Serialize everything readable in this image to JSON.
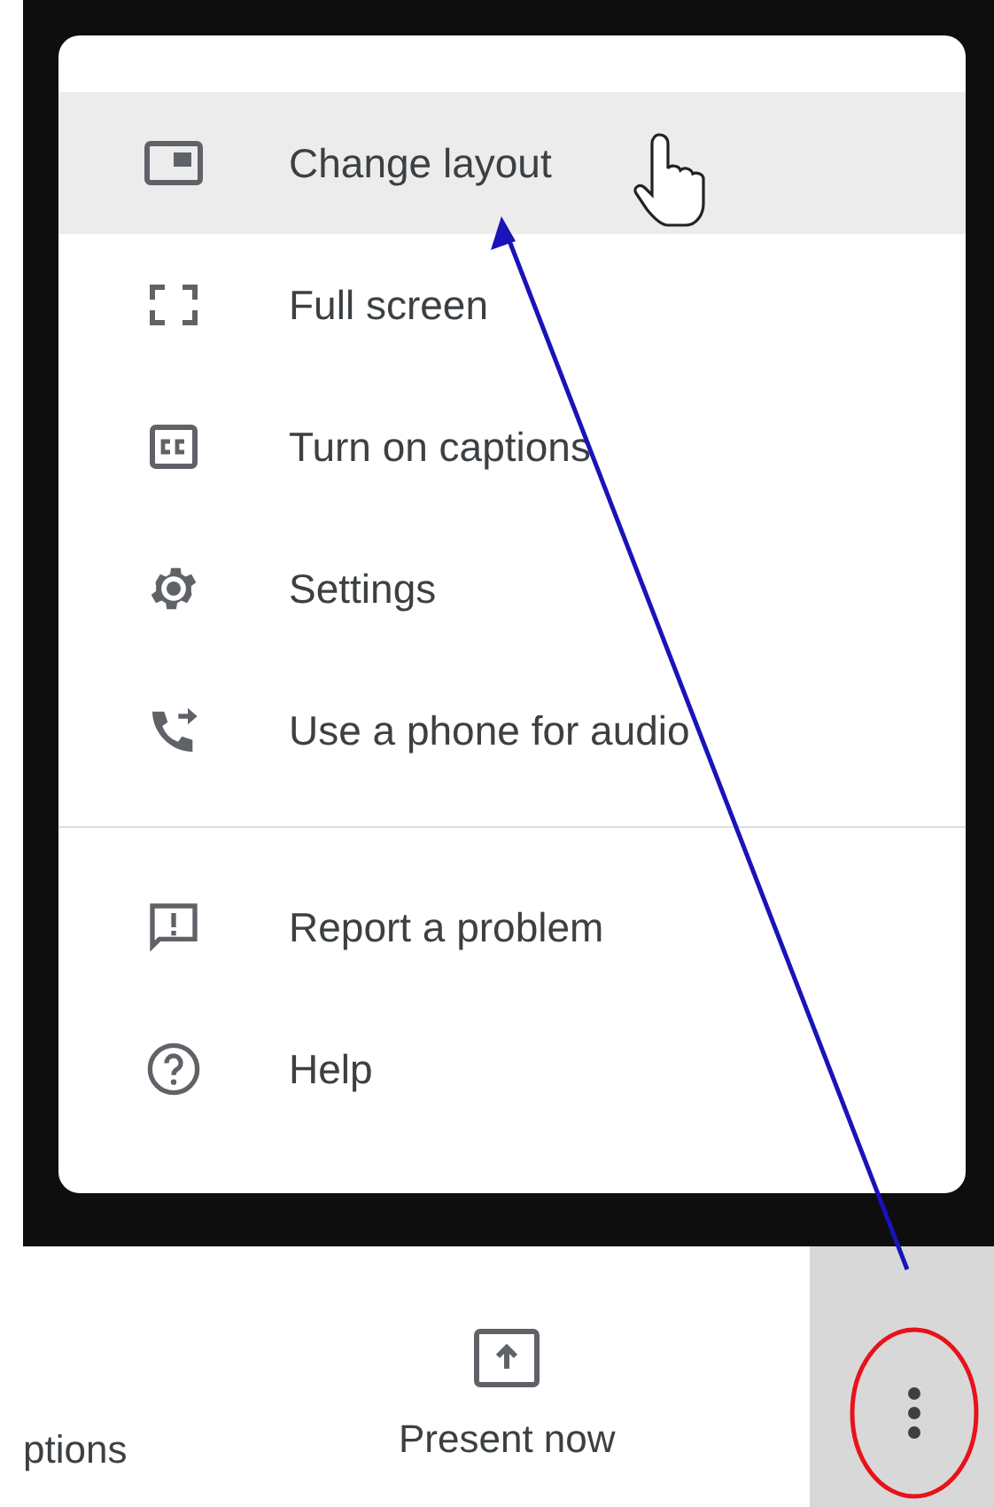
{
  "menu": {
    "sections": [
      {
        "items": [
          {
            "kind": "layout",
            "label": "Change layout",
            "selected": true
          },
          {
            "kind": "fullscreen",
            "label": "Full screen",
            "selected": false
          },
          {
            "kind": "captions",
            "label": "Turn on captions",
            "selected": false
          },
          {
            "kind": "settings",
            "label": "Settings",
            "selected": false
          },
          {
            "kind": "phone",
            "label": "Use a phone for audio",
            "selected": false
          }
        ]
      },
      {
        "items": [
          {
            "kind": "report",
            "label": "Report a problem",
            "selected": false
          },
          {
            "kind": "help",
            "label": "Help",
            "selected": false
          }
        ]
      }
    ]
  },
  "toolbar": {
    "cut_label": "ptions",
    "present": {
      "label": "Present now"
    },
    "more": {
      "highlighted": true
    }
  }
}
